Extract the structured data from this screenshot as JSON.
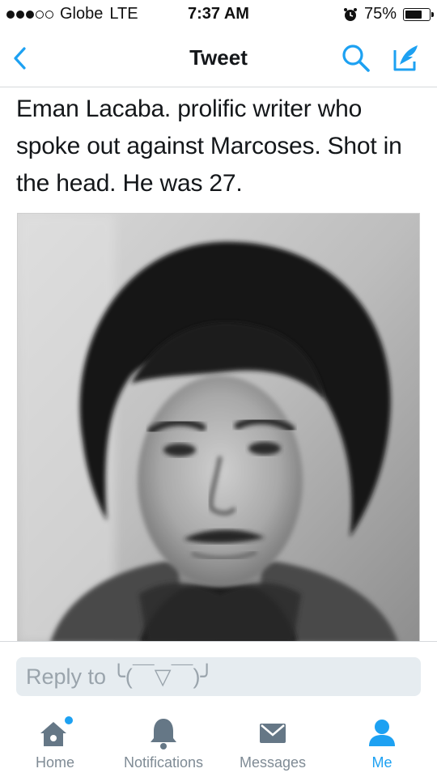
{
  "status_bar": {
    "carrier": "Globe",
    "network": "LTE",
    "time": "7:37 AM",
    "battery": "75%",
    "battery_level": 0.75,
    "signal_bars": 3,
    "signal_total": 5
  },
  "nav": {
    "title": "Tweet",
    "back_icon": "chevron-left-icon",
    "search_icon": "search-icon",
    "compose_icon": "compose-icon"
  },
  "tweet": {
    "text": "Eman Lacaba. prolific writer who spoke out against Marcoses. Shot in the head. He was 27."
  },
  "reply": {
    "placeholder": "Reply to ╰(￣▽￣)╯"
  },
  "tabs": [
    {
      "label": "Home",
      "icon": "home-icon",
      "active": false,
      "has_notification_dot": true
    },
    {
      "label": "Notifications",
      "icon": "bell-icon",
      "active": false
    },
    {
      "label": "Messages",
      "icon": "envelope-icon",
      "active": false
    },
    {
      "label": "Me",
      "icon": "person-icon",
      "active": true
    }
  ],
  "colors": {
    "accent": "#1da1f2",
    "tab_inactive": "#657786",
    "reply_bg": "#e6ecf0",
    "notification_dot": "#1da1f2"
  }
}
